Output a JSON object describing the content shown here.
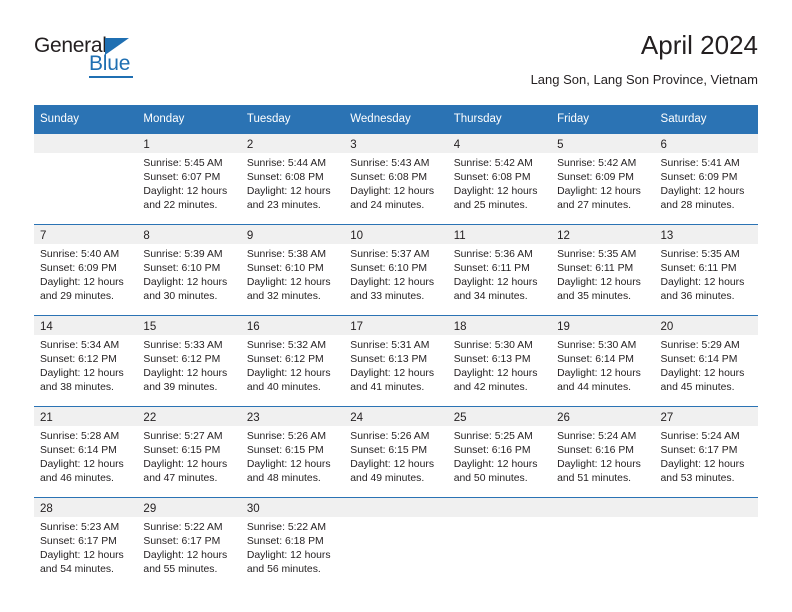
{
  "brand": {
    "name_top": "General",
    "name_bottom": "Blue",
    "accent_color": "#1f6fb2"
  },
  "header": {
    "title": "April 2024",
    "subtitle": "Lang Son, Lang Son Province, Vietnam"
  },
  "theme": {
    "header_row_bg": "#2b73b4",
    "daynum_band_bg": "#f0f0f0",
    "text_color": "#231f20",
    "divider_color": "#2b73b4"
  },
  "weekday_headers": [
    "Sunday",
    "Monday",
    "Tuesday",
    "Wednesday",
    "Thursday",
    "Friday",
    "Saturday"
  ],
  "weeks": [
    [
      {
        "day": "",
        "lines": []
      },
      {
        "day": "1",
        "lines": [
          "Sunrise: 5:45 AM",
          "Sunset: 6:07 PM",
          "Daylight: 12 hours",
          "and 22 minutes."
        ]
      },
      {
        "day": "2",
        "lines": [
          "Sunrise: 5:44 AM",
          "Sunset: 6:08 PM",
          "Daylight: 12 hours",
          "and 23 minutes."
        ]
      },
      {
        "day": "3",
        "lines": [
          "Sunrise: 5:43 AM",
          "Sunset: 6:08 PM",
          "Daylight: 12 hours",
          "and 24 minutes."
        ]
      },
      {
        "day": "4",
        "lines": [
          "Sunrise: 5:42 AM",
          "Sunset: 6:08 PM",
          "Daylight: 12 hours",
          "and 25 minutes."
        ]
      },
      {
        "day": "5",
        "lines": [
          "Sunrise: 5:42 AM",
          "Sunset: 6:09 PM",
          "Daylight: 12 hours",
          "and 27 minutes."
        ]
      },
      {
        "day": "6",
        "lines": [
          "Sunrise: 5:41 AM",
          "Sunset: 6:09 PM",
          "Daylight: 12 hours",
          "and 28 minutes."
        ]
      }
    ],
    [
      {
        "day": "7",
        "lines": [
          "Sunrise: 5:40 AM",
          "Sunset: 6:09 PM",
          "Daylight: 12 hours",
          "and 29 minutes."
        ]
      },
      {
        "day": "8",
        "lines": [
          "Sunrise: 5:39 AM",
          "Sunset: 6:10 PM",
          "Daylight: 12 hours",
          "and 30 minutes."
        ]
      },
      {
        "day": "9",
        "lines": [
          "Sunrise: 5:38 AM",
          "Sunset: 6:10 PM",
          "Daylight: 12 hours",
          "and 32 minutes."
        ]
      },
      {
        "day": "10",
        "lines": [
          "Sunrise: 5:37 AM",
          "Sunset: 6:10 PM",
          "Daylight: 12 hours",
          "and 33 minutes."
        ]
      },
      {
        "day": "11",
        "lines": [
          "Sunrise: 5:36 AM",
          "Sunset: 6:11 PM",
          "Daylight: 12 hours",
          "and 34 minutes."
        ]
      },
      {
        "day": "12",
        "lines": [
          "Sunrise: 5:35 AM",
          "Sunset: 6:11 PM",
          "Daylight: 12 hours",
          "and 35 minutes."
        ]
      },
      {
        "day": "13",
        "lines": [
          "Sunrise: 5:35 AM",
          "Sunset: 6:11 PM",
          "Daylight: 12 hours",
          "and 36 minutes."
        ]
      }
    ],
    [
      {
        "day": "14",
        "lines": [
          "Sunrise: 5:34 AM",
          "Sunset: 6:12 PM",
          "Daylight: 12 hours",
          "and 38 minutes."
        ]
      },
      {
        "day": "15",
        "lines": [
          "Sunrise: 5:33 AM",
          "Sunset: 6:12 PM",
          "Daylight: 12 hours",
          "and 39 minutes."
        ]
      },
      {
        "day": "16",
        "lines": [
          "Sunrise: 5:32 AM",
          "Sunset: 6:12 PM",
          "Daylight: 12 hours",
          "and 40 minutes."
        ]
      },
      {
        "day": "17",
        "lines": [
          "Sunrise: 5:31 AM",
          "Sunset: 6:13 PM",
          "Daylight: 12 hours",
          "and 41 minutes."
        ]
      },
      {
        "day": "18",
        "lines": [
          "Sunrise: 5:30 AM",
          "Sunset: 6:13 PM",
          "Daylight: 12 hours",
          "and 42 minutes."
        ]
      },
      {
        "day": "19",
        "lines": [
          "Sunrise: 5:30 AM",
          "Sunset: 6:14 PM",
          "Daylight: 12 hours",
          "and 44 minutes."
        ]
      },
      {
        "day": "20",
        "lines": [
          "Sunrise: 5:29 AM",
          "Sunset: 6:14 PM",
          "Daylight: 12 hours",
          "and 45 minutes."
        ]
      }
    ],
    [
      {
        "day": "21",
        "lines": [
          "Sunrise: 5:28 AM",
          "Sunset: 6:14 PM",
          "Daylight: 12 hours",
          "and 46 minutes."
        ]
      },
      {
        "day": "22",
        "lines": [
          "Sunrise: 5:27 AM",
          "Sunset: 6:15 PM",
          "Daylight: 12 hours",
          "and 47 minutes."
        ]
      },
      {
        "day": "23",
        "lines": [
          "Sunrise: 5:26 AM",
          "Sunset: 6:15 PM",
          "Daylight: 12 hours",
          "and 48 minutes."
        ]
      },
      {
        "day": "24",
        "lines": [
          "Sunrise: 5:26 AM",
          "Sunset: 6:15 PM",
          "Daylight: 12 hours",
          "and 49 minutes."
        ]
      },
      {
        "day": "25",
        "lines": [
          "Sunrise: 5:25 AM",
          "Sunset: 6:16 PM",
          "Daylight: 12 hours",
          "and 50 minutes."
        ]
      },
      {
        "day": "26",
        "lines": [
          "Sunrise: 5:24 AM",
          "Sunset: 6:16 PM",
          "Daylight: 12 hours",
          "and 51 minutes."
        ]
      },
      {
        "day": "27",
        "lines": [
          "Sunrise: 5:24 AM",
          "Sunset: 6:17 PM",
          "Daylight: 12 hours",
          "and 53 minutes."
        ]
      }
    ],
    [
      {
        "day": "28",
        "lines": [
          "Sunrise: 5:23 AM",
          "Sunset: 6:17 PM",
          "Daylight: 12 hours",
          "and 54 minutes."
        ]
      },
      {
        "day": "29",
        "lines": [
          "Sunrise: 5:22 AM",
          "Sunset: 6:17 PM",
          "Daylight: 12 hours",
          "and 55 minutes."
        ]
      },
      {
        "day": "30",
        "lines": [
          "Sunrise: 5:22 AM",
          "Sunset: 6:18 PM",
          "Daylight: 12 hours",
          "and 56 minutes."
        ]
      },
      {
        "day": "",
        "lines": []
      },
      {
        "day": "",
        "lines": []
      },
      {
        "day": "",
        "lines": []
      },
      {
        "day": "",
        "lines": []
      }
    ]
  ]
}
